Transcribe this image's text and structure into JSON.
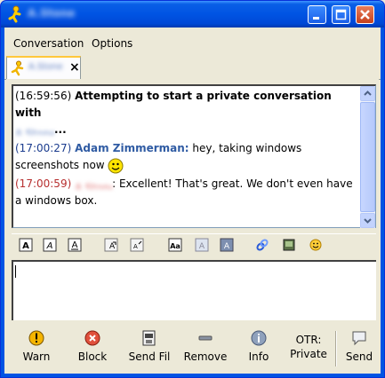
{
  "window": {
    "title": "A.Stone"
  },
  "menu": {
    "conversation": "Conversation",
    "options": "Options"
  },
  "tab": {
    "label": "A.Stone",
    "close": "×"
  },
  "log": {
    "messages": [
      {
        "time": "(16:59:56)",
        "text": "Attempting to start a private conversation with",
        "who": "A.Stone",
        "tail": "..."
      },
      {
        "time": "(17:00:27)",
        "sender": "Adam Zimmerman:",
        "text": "hey, taking windows screenshots now"
      },
      {
        "time": "(17:00:59)",
        "sender": "A.Stone",
        "text": ": Excellent!  That's great.  We don't even have a windows box."
      }
    ]
  },
  "buttons": {
    "warn": "Warn",
    "block": "Block",
    "send_file": "Send Fil",
    "remove": "Remove",
    "info": "Info",
    "otr_line1": "OTR:",
    "otr_line2": "Private",
    "send": "Send"
  },
  "colors": {
    "titlebar": "#0054e3",
    "timestamp": "#1b3c8e",
    "local_timestamp": "#b72f2f",
    "sender": "#2f5ba3"
  }
}
